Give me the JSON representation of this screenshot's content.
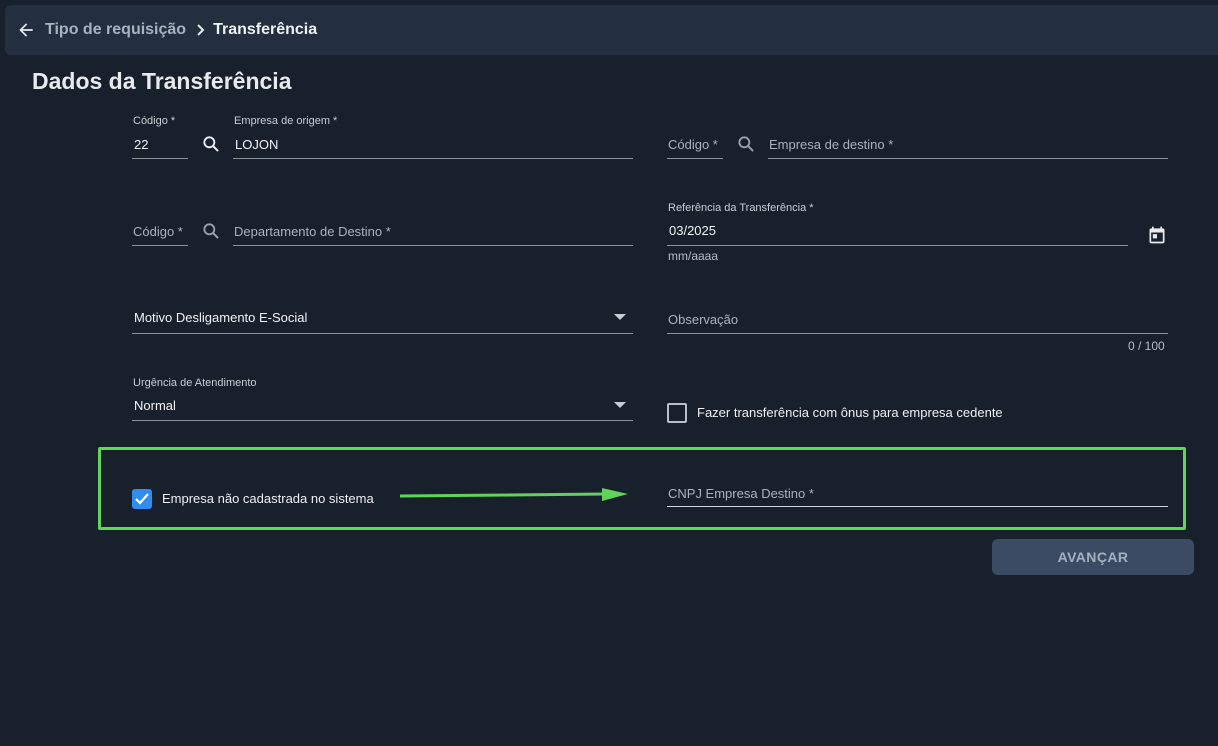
{
  "breadcrumb": {
    "parent": "Tipo de requisição",
    "current": "Transferência"
  },
  "page_title": "Dados da Transferência",
  "origem": {
    "codigo_label": "Código *",
    "codigo_value": "22",
    "empresa_label": "Empresa de origem *",
    "empresa_value": "LOJON"
  },
  "destino": {
    "codigo_placeholder": "Código *",
    "empresa_placeholder": "Empresa de destino *"
  },
  "departamento": {
    "codigo_placeholder": "Código *",
    "placeholder": "Departamento de Destino *"
  },
  "referencia": {
    "label": "Referência da Transferência *",
    "value": "03/2025",
    "hint": "mm/aaaa"
  },
  "motivo": {
    "value": "Motivo Desligamento E-Social"
  },
  "observacao": {
    "placeholder": "Observação",
    "counter": "0 / 100"
  },
  "urgencia": {
    "label": "Urgência de Atendimento",
    "value": "Normal"
  },
  "onus_checkbox": {
    "label": "Fazer transferência com ônus para empresa cedente",
    "checked": false
  },
  "empresa_nao_cadastrada": {
    "label": "Empresa não cadastrada no sistema",
    "checked": true
  },
  "cnpj": {
    "placeholder": "CNPJ Empresa Destino *"
  },
  "actions": {
    "avancar": "AVANÇAR"
  },
  "colors": {
    "background": "#18202b",
    "topbar": "#232f3e",
    "highlight": "#5fd35a",
    "checkbox_accent": "#2f8cf0",
    "button": "#3a4b63"
  }
}
